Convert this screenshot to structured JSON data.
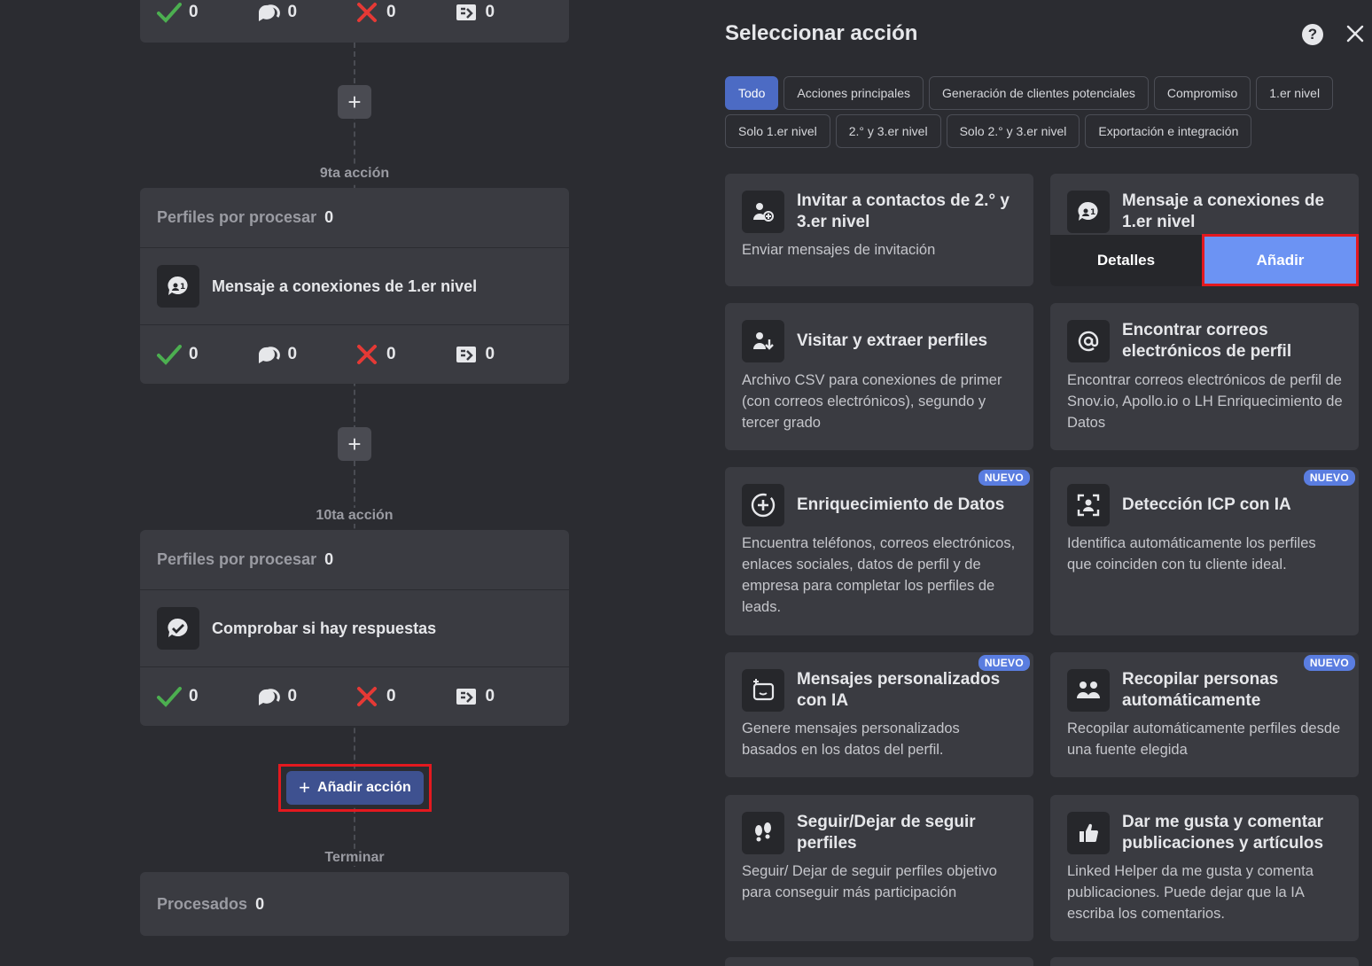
{
  "flow": {
    "top_stats": {
      "ok": "0",
      "replied": "0",
      "failed": "0",
      "skipped": "0"
    },
    "steps": [
      {
        "label": "9ta acción",
        "profiles_label": "Perfiles por procesar",
        "profiles_count": "0",
        "action_title": "Mensaje a conexiones de 1.er nivel",
        "stats": {
          "ok": "0",
          "replied": "0",
          "failed": "0",
          "skipped": "0"
        }
      },
      {
        "label": "10ta acción",
        "profiles_label": "Perfiles por procesar",
        "profiles_count": "0",
        "action_title": "Comprobar si hay respuestas",
        "stats": {
          "ok": "0",
          "replied": "0",
          "failed": "0",
          "skipped": "0"
        }
      }
    ],
    "add_action_label": "Añadir acción",
    "end_label": "Terminar",
    "processed_label": "Procesados",
    "processed_count": "0"
  },
  "panel": {
    "title": "Seleccionar acción",
    "filters": [
      "Todo",
      "Acciones principales",
      "Generación de clientes potenciales",
      "Compromiso",
      "1.er nivel",
      "Solo 1.er nivel",
      "2.° y 3.er nivel",
      "Solo 2.° y 3.er nivel",
      "Exportación e integración"
    ],
    "active_filter": "Todo",
    "tiles": [
      {
        "title": "Invitar a contactos de 2.° y 3.er nivel",
        "desc": "Enviar mensajes de invitación"
      },
      {
        "title": "Mensaje a conexiones de 1.er nivel",
        "details_label": "Detalles",
        "add_label": "Añadir"
      },
      {
        "title": "Visitar y extraer perfiles",
        "desc": "Archivo CSV para conexiones de primer (con correos electrónicos), segundo y tercer grado"
      },
      {
        "title": "Encontrar correos electrónicos de perfil",
        "desc": "Encontrar correos electrónicos de perfil de Snov.io, Apollo.io o LH Enriquecimiento de Datos"
      },
      {
        "title": "Enriquecimiento de Datos",
        "desc": "Encuentra teléfonos, correos electrónicos, enlaces sociales, datos de perfil y de empresa para completar los perfiles de leads.",
        "badge": "NUEVO"
      },
      {
        "title": "Detección ICP con IA",
        "desc": "Identifica automáticamente los perfiles que coinciden con tu cliente ideal.",
        "badge": "NUEVO"
      },
      {
        "title": "Mensajes personalizados con IA",
        "desc": "Genere mensajes personalizados basados en los datos del perfil.",
        "badge": "NUEVO"
      },
      {
        "title": "Recopilar personas automáticamente",
        "desc": "Recopilar automáticamente perfiles desde una fuente elegida",
        "badge": "NUEVO"
      },
      {
        "title": "Seguir/Dejar de seguir perfiles",
        "desc": "Seguir/ Dejar de seguir perfiles objetivo para conseguir más participación"
      },
      {
        "title": "Dar me gusta y comentar publicaciones y artículos",
        "desc": "Linked Helper da me gusta y comenta publicaciones. Puede dejar que la IA escriba los comentarios."
      }
    ]
  },
  "colors": {
    "accent": "#6c93f3",
    "active_chip": "#4c6bc4",
    "highlight": "#e3191f",
    "ok": "#4caf50",
    "fail": "#e53935"
  }
}
